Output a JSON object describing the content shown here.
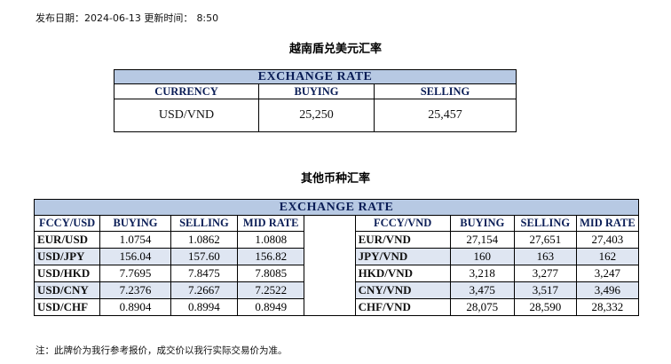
{
  "publish": {
    "label": "发布日期：2024-06-13 更新时间：",
    "time": "8:50"
  },
  "vnd_section": {
    "title": "越南盾兑美元汇率",
    "table_title": "EXCHANGE RATE",
    "headers": [
      "CURRENCY",
      "BUYING",
      "SELLING"
    ],
    "row": {
      "currency": "USD/VND",
      "buying": "25,250",
      "selling": "25,457"
    }
  },
  "other_section": {
    "title": "其他币种汇率",
    "table_title": "EXCHANGE  RATE",
    "left_headers": [
      "FCCY/USD",
      "BUYING",
      "SELLING",
      "MID RATE"
    ],
    "right_headers": [
      "FCCY/VND",
      "BUYING",
      "SELLING",
      "MID RATE"
    ],
    "rows": [
      {
        "l_pair": "EUR/USD",
        "l_buy": "1.0754",
        "l_sell": "1.0862",
        "l_mid": "1.0808",
        "r_pair": "EUR/VND",
        "r_buy": "27,154",
        "r_sell": "27,651",
        "r_mid": "27,403"
      },
      {
        "l_pair": "USD/JPY",
        "l_buy": "156.04",
        "l_sell": "157.60",
        "l_mid": "156.82",
        "r_pair": "JPY/VND",
        "r_buy": "160",
        "r_sell": "163",
        "r_mid": "162"
      },
      {
        "l_pair": "USD/HKD",
        "l_buy": "7.7695",
        "l_sell": "7.8475",
        "l_mid": "7.8085",
        "r_pair": "HKD/VND",
        "r_buy": "3,218",
        "r_sell": "3,277",
        "r_mid": "3,247"
      },
      {
        "l_pair": "USD/CNY",
        "l_buy": "7.2376",
        "l_sell": "7.2667",
        "l_mid": "7.2522",
        "r_pair": "CNY/VND",
        "r_buy": "3,475",
        "r_sell": "3,517",
        "r_mid": "3,496"
      },
      {
        "l_pair": "USD/CHF",
        "l_buy": "0.8904",
        "l_sell": "0.8994",
        "l_mid": "0.8949",
        "r_pair": "CHF/VND",
        "r_buy": "28,075",
        "r_sell": "28,590",
        "r_mid": "28,332"
      }
    ]
  },
  "note": "注：此牌价为我行参考报价，成交价以我行实际交易价为准。"
}
